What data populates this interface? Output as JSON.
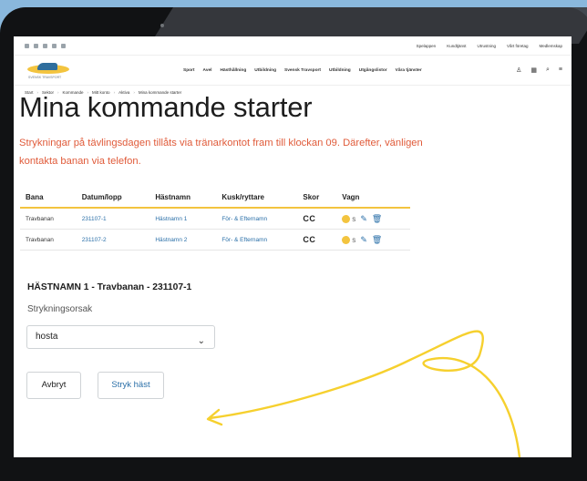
{
  "util": {
    "links": [
      "Spelappen",
      "Kundtjänst",
      "Utrustning",
      "Vårt företag",
      "Medlemskap"
    ]
  },
  "header": {
    "logo_sub": "SVENSK TRAVSPORT",
    "menu": [
      "Sport",
      "Avel",
      "Hästhållning",
      "Utbildning",
      "Svensk Travsport",
      "Utbildning",
      "Utgångslistor",
      "Våra tjänster"
    ]
  },
  "breadcrumb": [
    "Start",
    "Sektor",
    "Kommande",
    "Mitt konto",
    "Aktiva",
    "Mina kommande starter"
  ],
  "page": {
    "title": "Mina kommande starter",
    "notice": "Strykningar på tävlingsdagen tillåts via tränarkontot fram till klockan 09. Därefter, vänligen kontakta banan via telefon."
  },
  "table": {
    "headers": [
      "Bana",
      "Datum/lopp",
      "Hästnamn",
      "Kusk/ryttare",
      "Skor",
      "Vagn"
    ],
    "rows": [
      {
        "bana": "Travbanan",
        "datum": "231107-1",
        "hast": "Hästnamn 1",
        "kusk": "För- & Efternamn",
        "skor": "CC",
        "vagn": "S"
      },
      {
        "bana": "Travbanan",
        "datum": "231107-2",
        "hast": "Hästnamn 2",
        "kusk": "För- & Efternamn",
        "skor": "CC",
        "vagn": "S"
      }
    ]
  },
  "strike_form": {
    "heading": "HÄSTNAMN 1 - Travbanan - 231107-1",
    "reason_label": "Strykningsorsak",
    "reason_value": "hosta",
    "cancel_label": "Avbryt",
    "strike_label": "Stryk häst"
  },
  "colors": {
    "accent": "#f3c43f",
    "warning": "#e05b3a",
    "link": "#2a6fa8",
    "arrow": "#f6d02e"
  }
}
